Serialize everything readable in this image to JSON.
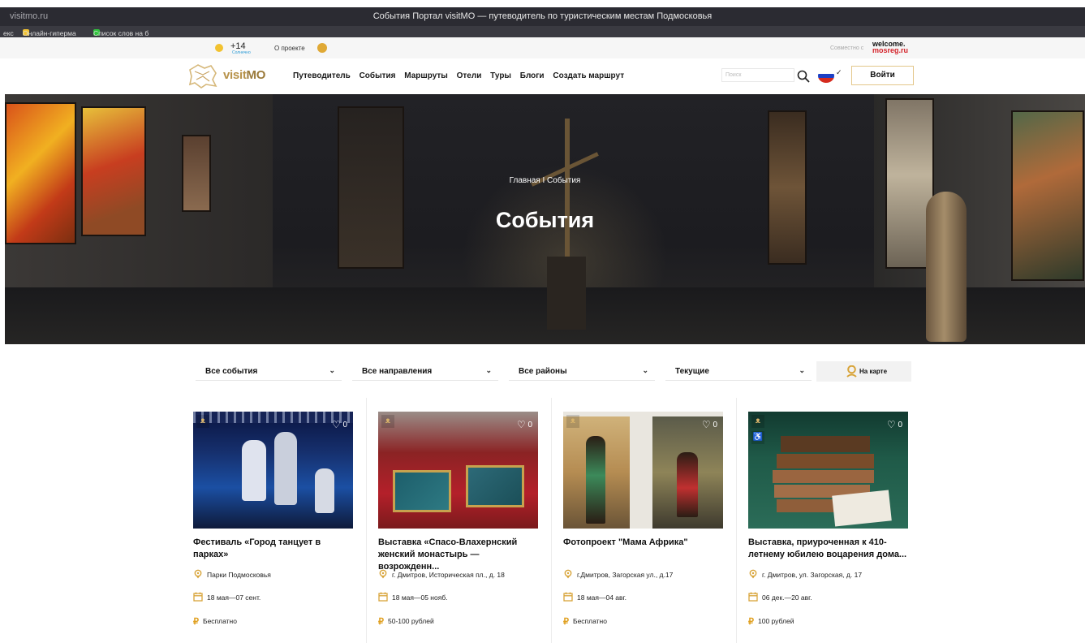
{
  "browser": {
    "domain": "visitmo.ru",
    "window_title": "События Портал visitMO — путеводитель по туристическим местам Подмосковья",
    "bookmarks": [
      {
        "label": "екс"
      },
      {
        "label": "Онлайн-гиперма"
      },
      {
        "label": "Список слов на б"
      }
    ]
  },
  "infobar": {
    "temperature": "+14",
    "temperature_note": "Солнечно",
    "about_label": "О проекте",
    "together_label": "Совместно с",
    "welcome_top": "welcome.",
    "welcome_bottom": "mosreg.ru"
  },
  "header": {
    "logo_text_a": "visit",
    "logo_text_b": "MO",
    "nav": [
      "Путеводитель",
      "События",
      "Маршруты",
      "Отели",
      "Туры",
      "Блоги",
      "Создать маршрут"
    ],
    "search_placeholder": "Поиск",
    "login_label": "Войти"
  },
  "hero": {
    "breadcrumb": "Главная I События",
    "title": "События"
  },
  "filters": [
    {
      "label": "Все события"
    },
    {
      "label": "Все направления"
    },
    {
      "label": "Все районы"
    },
    {
      "label": "Текущие"
    }
  ],
  "map_button": "На карте",
  "events": [
    {
      "title": "Фестиваль «Город танцует в парках»",
      "likes": "0",
      "location": "Парки Подмосковья",
      "dates": "18 мая—07 сент.",
      "price": "Бесплатно"
    },
    {
      "title": "Выставка «Спасо-Влахернский женский монастырь — возрожденн...",
      "likes": "0",
      "location": "г. Дмитров, Историческая пл., д. 18",
      "dates": "18 мая—05 нояб.",
      "price": "50-100 рублей"
    },
    {
      "title": "Фотопроект \"Мама Африка\"",
      "likes": "0",
      "location": "г.Дмитров, Загорская ул., д.17",
      "dates": "18 мая—04 авг.",
      "price": "Бесплатно"
    },
    {
      "title": "Выставка, приуроченная к 410-летнему юбилею воцарения дома...",
      "likes": "0",
      "location": "г. Дмитров, ул. Загорская, д. 17",
      "dates": "06 дек.—20 авг.",
      "price": "100 рублей"
    }
  ]
}
